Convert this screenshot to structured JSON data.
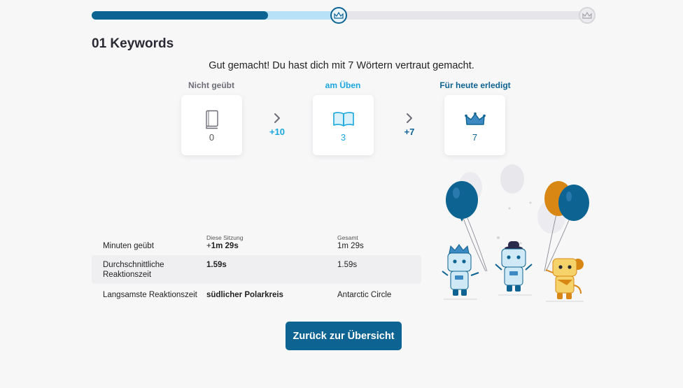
{
  "progress": {
    "completed_fraction": 0.35,
    "active_fraction": 0.49
  },
  "colors": {
    "primary": "#0d6391",
    "active_blue": "#1aa7dd",
    "light_blue": "#b7e1f6",
    "muted": "#6d6d78"
  },
  "header": {
    "title": "01 Keywords"
  },
  "summary": {
    "message": "Gut gemacht! Du hast dich mit 7 Wörtern vertraut gemacht."
  },
  "stages": [
    {
      "label": "Nicht geübt",
      "count": "0",
      "icon": "book-closed-icon"
    },
    {
      "label": "am Üben",
      "count": "3",
      "icon": "book-open-icon"
    },
    {
      "label": "Für heute erledigt",
      "count": "7",
      "icon": "crown-icon"
    }
  ],
  "deltas": [
    "+10",
    "+7"
  ],
  "stats": {
    "col_session": "Diese Sitzung",
    "col_total": "Gesamt",
    "rows": [
      {
        "label": "Minuten geübt",
        "session_prefix": "+",
        "session": "1m 29s",
        "total": "1m 29s"
      },
      {
        "label": "Durchschnittliche Reaktionszeit",
        "session": "1.59s",
        "total": "1.59s"
      },
      {
        "label": "Langsamste Reaktionszeit",
        "session": "südlicher Polarkreis",
        "total": "Antarctic Circle"
      }
    ]
  },
  "actions": {
    "back_label": "Zurück zur Übersicht"
  }
}
